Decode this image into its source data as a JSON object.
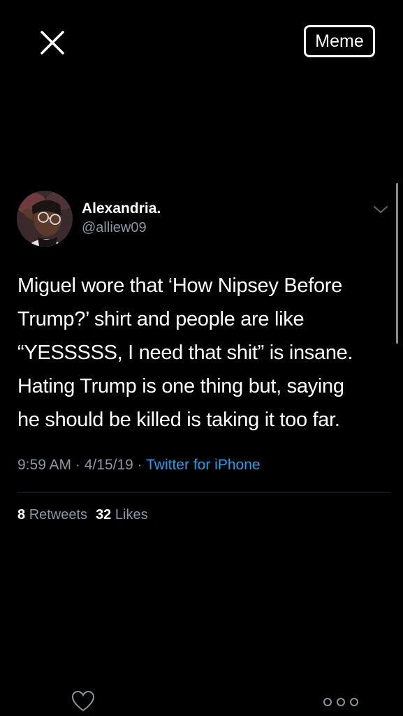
{
  "header": {
    "close_icon": "close-icon",
    "meme_label": "Meme"
  },
  "tweet": {
    "author": {
      "name": "Alexandria.",
      "handle": "@alliew09",
      "avatar_icon": "avatar"
    },
    "text_lines": [
      "Miguel wore that ‘How Nipsey Before",
      "Trump?’ shirt and people are like",
      "“YESSSSS, I need that shit” is insane.",
      "Hating Trump is one thing but, saying",
      "he should be killed is taking it too far."
    ],
    "time": "9:59 AM",
    "separator": "·",
    "date": "4/15/19",
    "source": "Twitter for iPhone",
    "retweets": {
      "count": "8",
      "label": "Retweets"
    },
    "likes": {
      "count": "32",
      "label": "Likes"
    }
  },
  "actions": {
    "like_icon": "heart-icon",
    "more_icon": "more-options-icon"
  },
  "colors": {
    "background": "#000000",
    "text": "#ffffff",
    "secondary_text": "#8899a6",
    "link": "#1da1f2",
    "divider": "#2a2e33"
  }
}
